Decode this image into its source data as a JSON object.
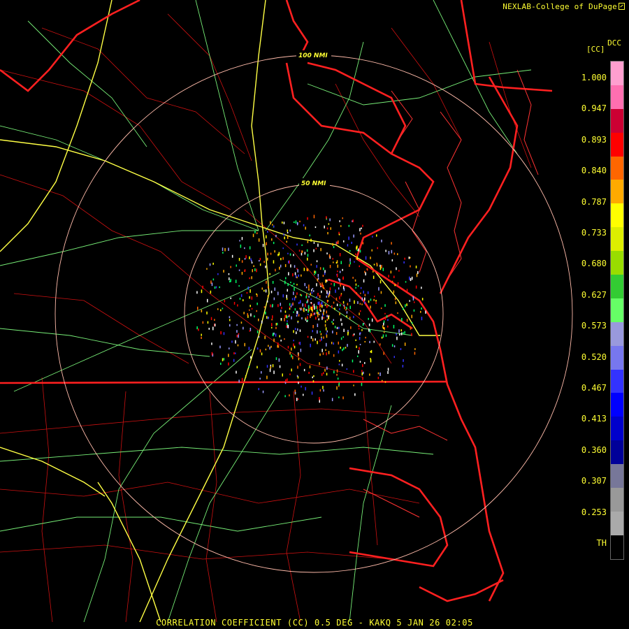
{
  "header": {
    "credit": "NEXLAB-College of DuPage",
    "credit_icon": "external-link-icon"
  },
  "legend": {
    "product_code": "DCC",
    "units": "[CC]",
    "ticks": [
      "1.000",
      "0.947",
      "0.893",
      "0.840",
      "0.787",
      "0.733",
      "0.680",
      "0.627",
      "0.573",
      "0.520",
      "0.467",
      "0.413",
      "0.360",
      "0.307",
      "0.253",
      "TH"
    ],
    "colors": [
      "#ff9fcf",
      "#ff6fb0",
      "#cc0033",
      "#ff0000",
      "#ff6600",
      "#ffaa00",
      "#ffff00",
      "#ddee00",
      "#99dd00",
      "#33cc33",
      "#66ff66",
      "#9999dd",
      "#7777ee",
      "#3333ff",
      "#0000ff",
      "#0000cc",
      "#000099",
      "#777799",
      "#999999",
      "#aaaaaa",
      "#000000"
    ]
  },
  "range_rings": {
    "inner_label": "50 NMI",
    "outer_label": "100 NMI",
    "inner_nmi": 50,
    "outer_nmi": 100
  },
  "footer": {
    "caption": "CORRELATION COEFFICIENT (CC) 0.5 DEG - KAKQ 5 JAN 26 02:05"
  },
  "colors": {
    "state_borders": "#ff2020",
    "county_borders": "#cc1111",
    "highways": "#ffff44",
    "roads": "#77ee77",
    "rings": "#ffbbaa",
    "text": "#ffff33"
  }
}
